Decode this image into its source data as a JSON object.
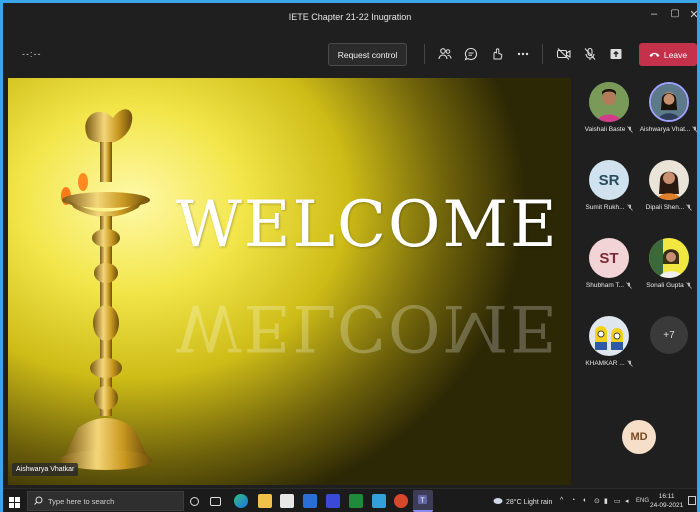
{
  "window": {
    "title": "IETE Chapter 21-22 Inugration",
    "minimize": "–",
    "maximize": "▢",
    "close": "✕"
  },
  "toolbar": {
    "timer": "--:--",
    "request_control": "Request control",
    "leave": "Leave"
  },
  "stage": {
    "welcome": "WELCOME",
    "presenter": "Aishwarya Vhatkar"
  },
  "participants": [
    {
      "name": "Vaishali Baste",
      "initials": "",
      "muted": true
    },
    {
      "name": "Aishwarya Vhat...",
      "initials": "",
      "muted": true
    },
    {
      "name": "Sumit Rukh...",
      "initials": "SR",
      "muted": true
    },
    {
      "name": "Dipali Shen...",
      "initials": "",
      "muted": true
    },
    {
      "name": "Shubham T...",
      "initials": "ST",
      "muted": true
    },
    {
      "name": "Sonali Gupta",
      "initials": "",
      "muted": true
    },
    {
      "name": "KHAMKAR ...",
      "initials": "",
      "muted": true
    }
  ],
  "more_count": "+7",
  "self_avatar": "MD",
  "taskbar": {
    "search_placeholder": "Type here to search",
    "weather": "28°C  Light rain",
    "lang": "ENG",
    "time": "16:11",
    "date": "24-09-2021"
  }
}
